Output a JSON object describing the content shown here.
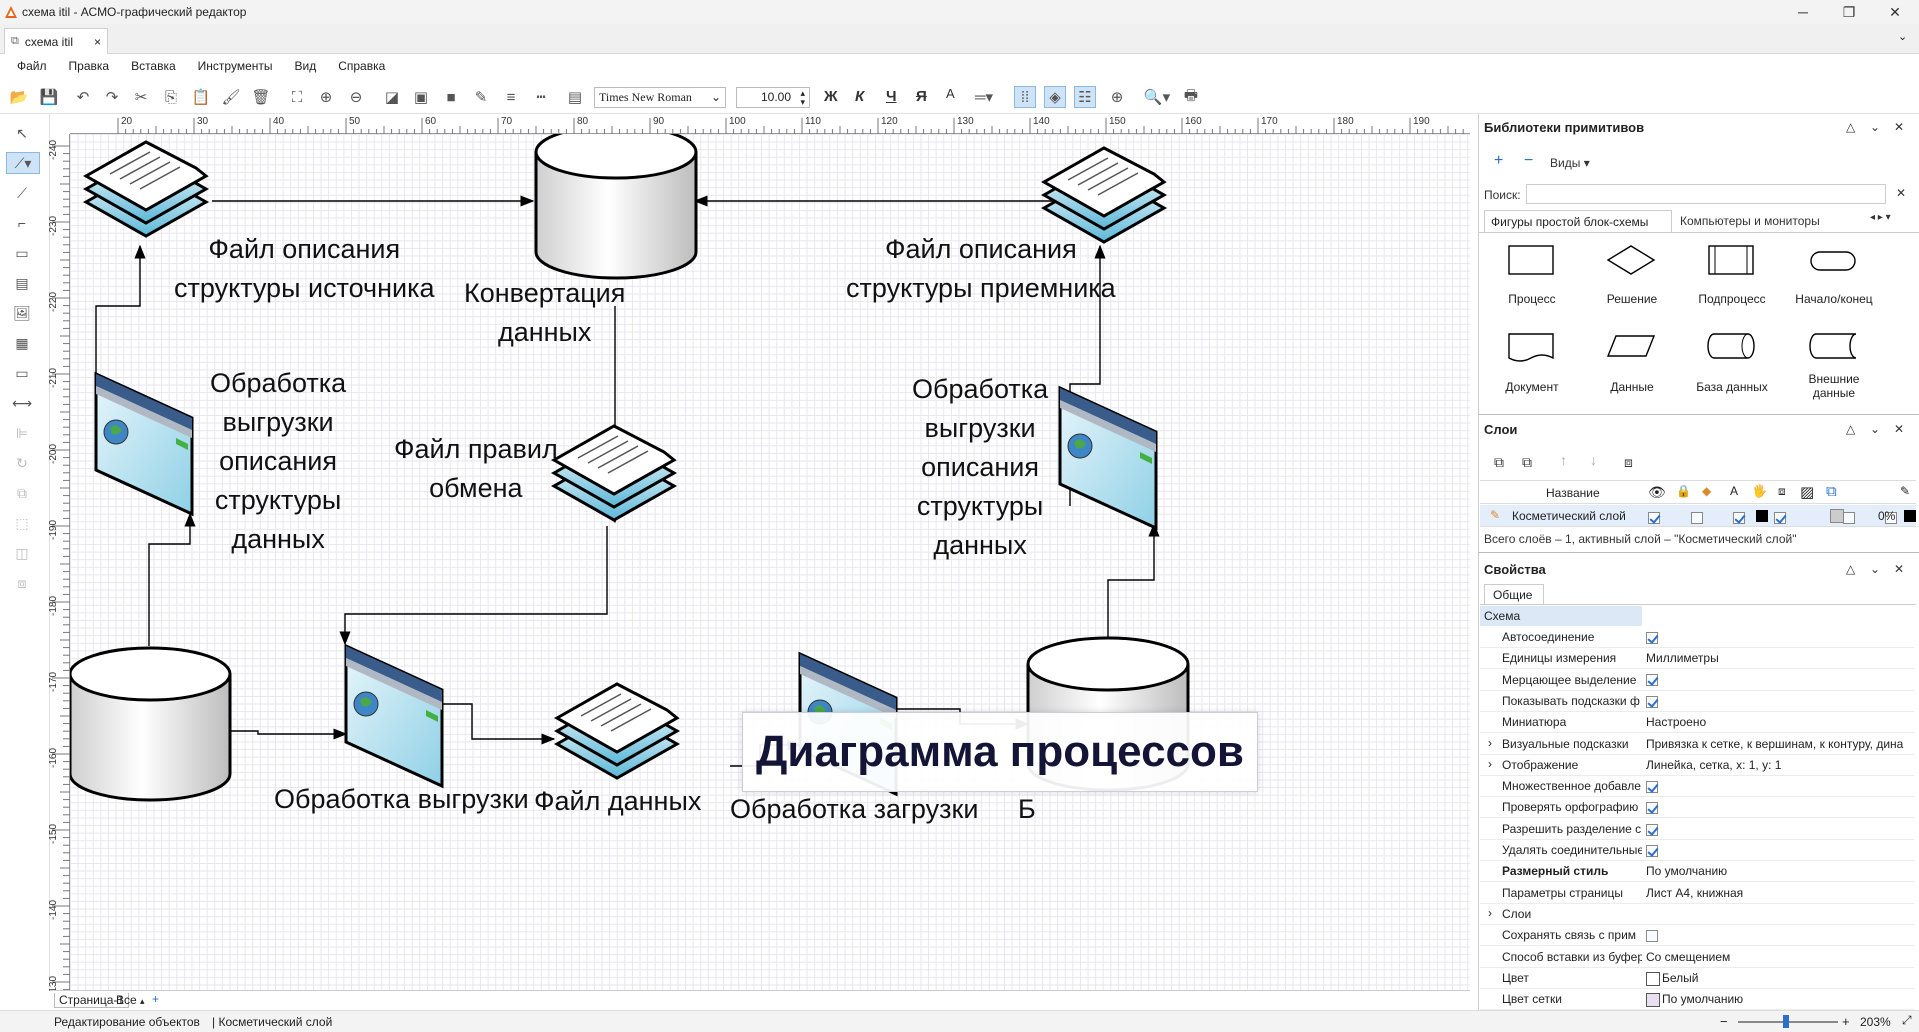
{
  "window": {
    "title": "схема itil - АСМО-графический редактор",
    "app_icon": "app-logo-icon",
    "controls": [
      "minimize",
      "maximize",
      "close"
    ]
  },
  "tab": {
    "label": "схема itil",
    "close": "×"
  },
  "menu": [
    "Файл",
    "Правка",
    "Вставка",
    "Инструменты",
    "Вид",
    "Справка"
  ],
  "toolbar": {
    "font": "Times New Roman",
    "size": "10.00",
    "bold": "Ж",
    "italic": "К",
    "underline": "Ч",
    "strike": "Я",
    "font_color": "A"
  },
  "ruler": {
    "h": [
      "20",
      "30",
      "40",
      "50",
      "60",
      "70",
      "80",
      "90",
      "100",
      "110",
      "120",
      "130",
      "140",
      "150",
      "160",
      "170",
      "180",
      "190"
    ],
    "v": [
      "-240",
      "-230",
      "-220",
      "-210",
      "-200",
      "-190",
      "-180",
      "-170",
      "-160",
      "-150",
      "-140",
      "-130"
    ]
  },
  "diagram": {
    "labels": [
      "Файл описания\nструктуры источника",
      "Конвертация\nданных",
      "Файл описания\nструктуры приемника",
      "Обработка\nвыгрузки\nописания\nструктуры\nданных",
      "Файл правил\nобмена",
      "Обработка\nвыгрузки\nописания\nструктуры\nданных",
      "Обработка выгрузки",
      "Файл данных",
      "Обработка загрузки",
      "Б"
    ],
    "banner": "Диаграмма процессов",
    "accent": "#5bb8d8"
  },
  "pages": {
    "tab": "Страница-1",
    "all": "Все",
    "add": "+"
  },
  "status": {
    "mode": "Редактирование объектов",
    "layer": "Косметический слой",
    "zoom": "203%"
  },
  "library": {
    "title": "Библиотеки примитивов",
    "views": "Виды",
    "search_label": "Поиск:",
    "tabs": [
      "Фигуры простой блок-схемы",
      "Компьютеры и мониторы"
    ],
    "shapes": [
      "Процесс",
      "Решение",
      "Подпроцесс",
      "Начало/конец",
      "Документ",
      "Данные",
      "База данных",
      "Внешние\nданные"
    ]
  },
  "layers": {
    "title": "Слои",
    "col_name": "Название",
    "row_name": "Косметический слой",
    "row_pct": "0%",
    "summary": "Всего слоёв – 1, активный слой – \"Косметический слой\""
  },
  "props": {
    "title": "Свойства",
    "tab": "Общие",
    "section": "Схема",
    "rows": [
      {
        "n": "Автосоединение",
        "v": "",
        "chk": true
      },
      {
        "n": "Единицы измерения",
        "v": "Миллиметры"
      },
      {
        "n": "Мерцающее выделение",
        "v": "",
        "chk": true
      },
      {
        "n": "Показывать подсказки ф",
        "v": "",
        "chk": true
      },
      {
        "n": "Миниатюра",
        "v": "Настроено"
      },
      {
        "n": "Визуальные подсказки",
        "v": "Привязка к сетке, к вершинам, к контуру, дина",
        "exp": true
      },
      {
        "n": "Отображение",
        "v": "Линейка, сетка, x: 1, y: 1",
        "exp": true
      },
      {
        "n": "Множественное добавле",
        "v": "",
        "chk": true
      },
      {
        "n": "Проверять орфографию",
        "v": "",
        "chk": true
      },
      {
        "n": "Разрешить разделение с",
        "v": "",
        "chk": true
      },
      {
        "n": "Удалять соединительные",
        "v": "",
        "chk": true
      },
      {
        "n": "Размерный стиль",
        "v": "По умолчанию",
        "bold": true
      },
      {
        "n": "Параметры страницы",
        "v": "Лист А4, книжная"
      },
      {
        "n": "Слои",
        "v": "",
        "exp": true
      },
      {
        "n": "Сохранять связь с прим",
        "v": "",
        "chk": false
      },
      {
        "n": "Способ вставки из буфер",
        "v": "Со смещением"
      },
      {
        "n": "Цвет",
        "v": "Белый",
        "swatch": "#ffffff"
      },
      {
        "n": "Цвет сетки",
        "v": "По умолчанию",
        "swatch": "#e8dff0"
      }
    ]
  }
}
